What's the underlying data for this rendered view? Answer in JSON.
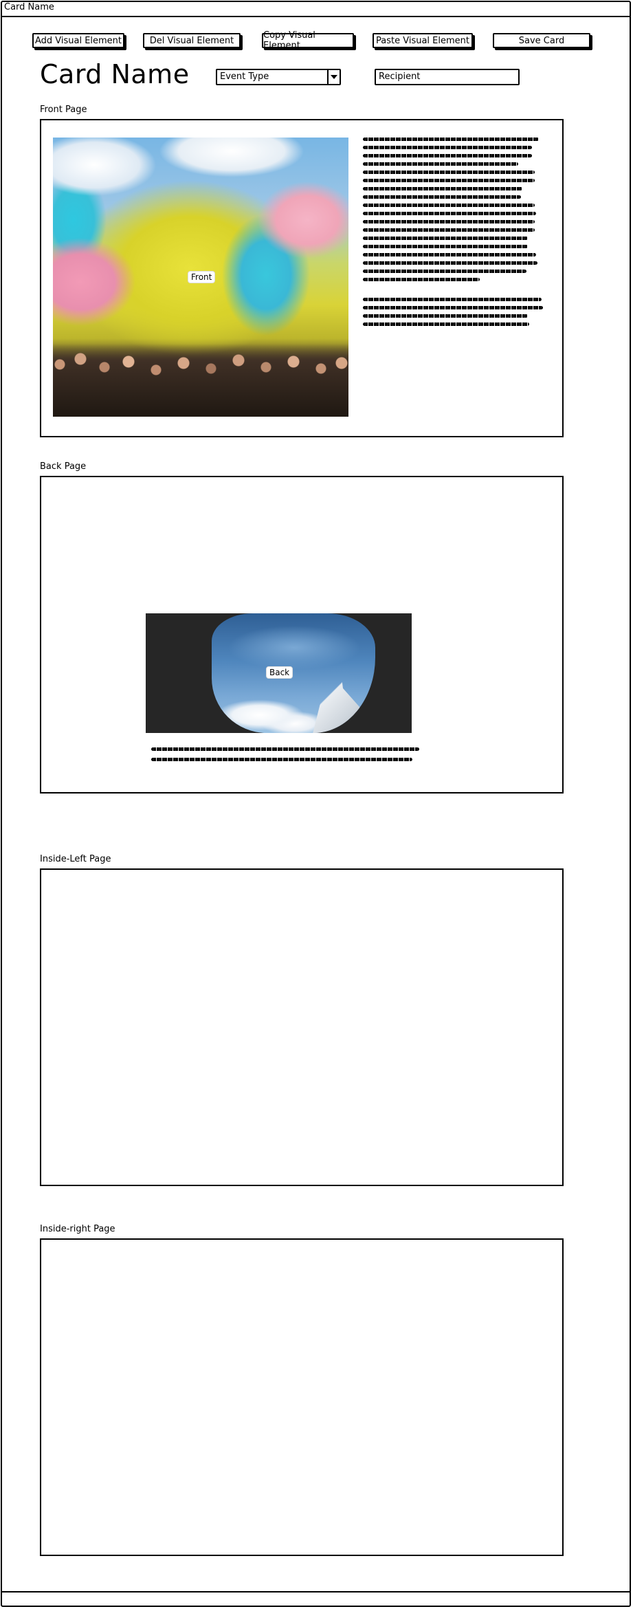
{
  "window": {
    "title": "Card Name"
  },
  "toolbar": {
    "add_label": "Add Visual Element",
    "del_label": "Del Visual Element",
    "copy_label": "Copy Visual Element",
    "paste_label": "Paste Visual Element",
    "save_label": "Save Card"
  },
  "header": {
    "card_name": "Card Name",
    "event_type": "Event Type",
    "recipient": "Recipient"
  },
  "pages": {
    "front": {
      "label": "Front Page",
      "image_label": "Front"
    },
    "back": {
      "label": "Back Page",
      "image_label": "Back"
    },
    "inside_left": {
      "label": "Inside-Left Page"
    },
    "inside_right": {
      "label": "Inside-right Page"
    }
  },
  "icons": {
    "dropdown": "chevron-down-icon"
  }
}
